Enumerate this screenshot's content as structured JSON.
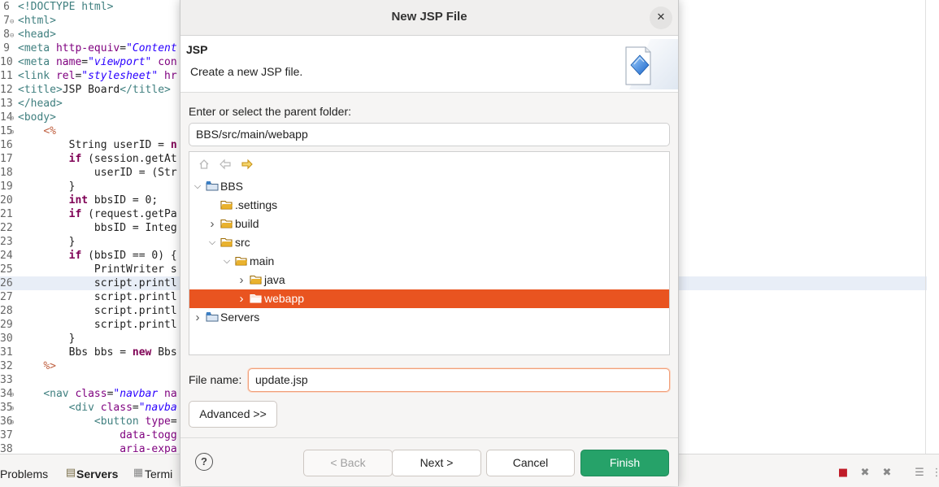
{
  "editor": {
    "lines": [
      {
        "n": "6",
        "fold": "",
        "html": "<span class='tag'>&lt;!DOCTYPE html&gt;</span>"
      },
      {
        "n": "7",
        "fold": "⊖",
        "html": "<span class='tag'>&lt;html&gt;</span>"
      },
      {
        "n": "8",
        "fold": "⊖",
        "html": "<span class='tag'>&lt;head&gt;</span>"
      },
      {
        "n": "9",
        "fold": "",
        "html": "<span class='tag'>&lt;meta</span> <span class='attr'>http-equiv</span>=<span class='str'>\"Content</span>"
      },
      {
        "n": "10",
        "fold": "",
        "html": "<span class='tag'>&lt;meta</span> <span class='attr'>name</span>=<span class='str'>\"viewport\"</span> <span class='attr'>con</span>"
      },
      {
        "n": "11",
        "fold": "",
        "html": "<span class='tag'>&lt;link</span> <span class='attr'>rel</span>=<span class='str'>\"stylesheet\"</span> <span class='attr'>hr</span>"
      },
      {
        "n": "12",
        "fold": "",
        "html": "<span class='tag'>&lt;title&gt;</span>JSP Board<span class='tag'>&lt;/title&gt;</span>"
      },
      {
        "n": "13",
        "fold": "",
        "html": "<span class='tag'>&lt;/head&gt;</span>"
      },
      {
        "n": "14",
        "fold": "⊖",
        "html": "<span class='tag'>&lt;body&gt;</span>"
      },
      {
        "n": "15",
        "fold": "⊖",
        "html": "    <span class='jsp'>&lt;%</span>"
      },
      {
        "n": "16",
        "fold": "",
        "html": "        String userID = <span class='kw'>n</span>"
      },
      {
        "n": "17",
        "fold": "",
        "html": "        <span class='kw'>if</span> (session.getAt"
      },
      {
        "n": "18",
        "fold": "",
        "html": "            userID = (Str"
      },
      {
        "n": "19",
        "fold": "",
        "html": "        }"
      },
      {
        "n": "20",
        "fold": "",
        "html": "        <span class='kw'>int</span> bbsID = 0;"
      },
      {
        "n": "21",
        "fold": "",
        "html": "        <span class='kw'>if</span> (request.getPa"
      },
      {
        "n": "22",
        "fold": "",
        "html": "            bbsID = Integ"
      },
      {
        "n": "23",
        "fold": "",
        "html": "        }"
      },
      {
        "n": "24",
        "fold": "",
        "html": "        <span class='kw'>if</span> (bbsID == 0) {"
      },
      {
        "n": "25",
        "fold": "",
        "html": "            PrintWriter s"
      },
      {
        "n": "26",
        "fold": "",
        "html": "            script.printl",
        "hl": true
      },
      {
        "n": "27",
        "fold": "",
        "html": "            script.printl"
      },
      {
        "n": "28",
        "fold": "",
        "html": "            script.printl"
      },
      {
        "n": "29",
        "fold": "",
        "html": "            script.printl"
      },
      {
        "n": "30",
        "fold": "",
        "html": "        }"
      },
      {
        "n": "31",
        "fold": "",
        "html": "        Bbs bbs = <span class='kw'>new</span> Bbs"
      },
      {
        "n": "32",
        "fold": "",
        "html": "    <span class='jsp'>%&gt;</span>"
      },
      {
        "n": "33",
        "fold": "",
        "html": ""
      },
      {
        "n": "34",
        "fold": "⊖",
        "html": "    <span class='tag'>&lt;nav</span> <span class='attr'>class</span>=<span class='str'>\"navbar</span> <span class='attr'>na</span>"
      },
      {
        "n": "35",
        "fold": "⊖",
        "html": "        <span class='tag'>&lt;div</span> <span class='attr'>class</span>=<span class='str'>\"navba</span>"
      },
      {
        "n": "36",
        "fold": "⊖",
        "html": "            <span class='tag'>&lt;button</span> <span class='attr'>type</span>="
      },
      {
        "n": "37",
        "fold": "",
        "html": "                <span class='attr'>data-togg</span>"
      },
      {
        "n": "38",
        "fold": "",
        "html": "                <span class='attr'>aria-expa</span>"
      }
    ]
  },
  "bottom_panel": {
    "tabs": [
      "Problems",
      "Servers",
      "Termi"
    ]
  },
  "dialog": {
    "title": "New JSP File",
    "close_glyph": "✕",
    "header_title": "JSP",
    "header_description": "Create a new JSP file.",
    "parent_folder_label": "Enter or select the parent folder:",
    "parent_folder_value": "BBS/src/main/webapp",
    "tree": [
      {
        "label": "BBS",
        "depth": 0,
        "expand": "open",
        "icon": "project-folder-icon"
      },
      {
        "label": ".settings",
        "depth": 1,
        "expand": "none",
        "icon": "folder-icon"
      },
      {
        "label": "build",
        "depth": 1,
        "expand": "closed",
        "icon": "folder-icon"
      },
      {
        "label": "src",
        "depth": 1,
        "expand": "open",
        "icon": "folder-icon"
      },
      {
        "label": "main",
        "depth": 2,
        "expand": "open",
        "icon": "folder-icon"
      },
      {
        "label": "java",
        "depth": 3,
        "expand": "closed",
        "icon": "folder-icon"
      },
      {
        "label": "webapp",
        "depth": 3,
        "expand": "closed",
        "icon": "folder-icon",
        "selected": true
      },
      {
        "label": "Servers",
        "depth": 0,
        "expand": "closed",
        "icon": "project-folder-icon"
      }
    ],
    "file_name_label": "File name:",
    "file_name_value": "update.jsp",
    "advanced_button": "Advanced >>",
    "buttons": {
      "help": "?",
      "back": "< Back",
      "next": "Next >",
      "cancel": "Cancel",
      "finish": "Finish"
    },
    "colors": {
      "selection": "#e95420",
      "finish": "#26a269",
      "folder": "#e5a50a"
    }
  }
}
